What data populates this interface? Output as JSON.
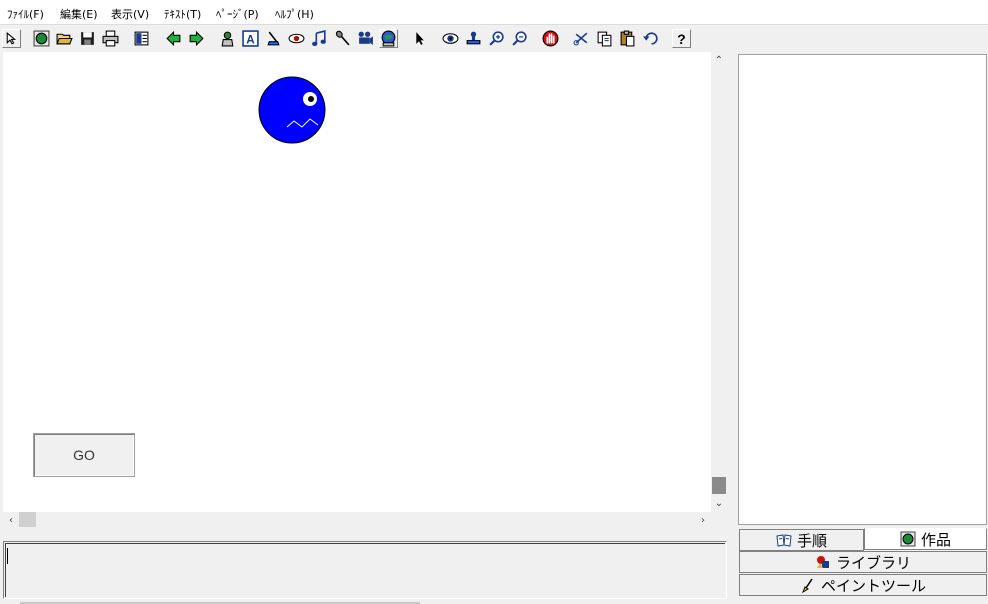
{
  "menu": [
    {
      "label": "ﾌｧｲﾙ(F)"
    },
    {
      "label": "編集(E)"
    },
    {
      "label": "表示(V)"
    },
    {
      "label": "ﾃｷｽﾄ(T)"
    },
    {
      "label": "ﾍﾟｰｼﾞ(P)"
    },
    {
      "label": "ﾍﾙﾌﾟ(H)"
    }
  ],
  "toolbar": [
    {
      "icon": "cursor-small-icon"
    },
    {
      "icon": "globe-icon"
    },
    {
      "icon": "open-folder-icon"
    },
    {
      "icon": "save-icon"
    },
    {
      "icon": "print-icon"
    },
    {
      "icon": "page-layout-icon"
    },
    {
      "icon": "back-arrow-icon"
    },
    {
      "icon": "forward-arrow-icon"
    },
    {
      "icon": "character-icon"
    },
    {
      "icon": "text-box-icon"
    },
    {
      "icon": "paint-icon"
    },
    {
      "icon": "eye-shape-icon"
    },
    {
      "icon": "music-note-icon"
    },
    {
      "icon": "microphone-icon"
    },
    {
      "icon": "film-camera-icon"
    },
    {
      "icon": "world-bubble-icon"
    },
    {
      "icon": "arrow-pointer-icon"
    },
    {
      "icon": "eye-icon"
    },
    {
      "icon": "stamp-icon"
    },
    {
      "icon": "zoom-in-icon"
    },
    {
      "icon": "zoom-out-icon"
    },
    {
      "icon": "stop-hand-icon"
    },
    {
      "icon": "cut-icon"
    },
    {
      "icon": "copy-icon"
    },
    {
      "icon": "paste-icon"
    },
    {
      "icon": "undo-icon"
    },
    {
      "icon": "help-icon"
    }
  ],
  "canvas": {
    "go_button_label": "GO",
    "character_color": "#0000ff"
  },
  "tabs": {
    "procedure": "手順",
    "works": "作品",
    "library": "ライブラリ",
    "paint_tool": "ペイントツール"
  },
  "colors": {
    "accent_blue": "#0000ff"
  }
}
